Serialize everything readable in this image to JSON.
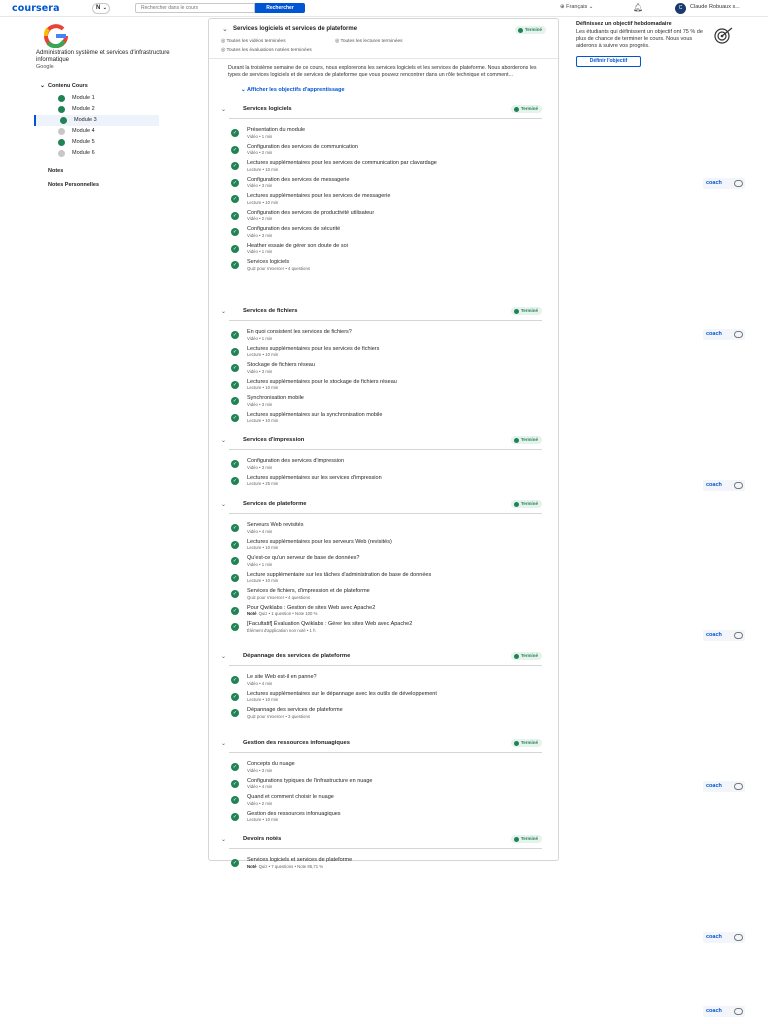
{
  "header": {
    "logo": "coursera",
    "badge_letter": "N",
    "badge_chevron": "⌄",
    "search_placeholder": "Rechercher dans le cours",
    "search_button": "Rechercher",
    "language": "Français",
    "avatar_letter": "C",
    "username": "Claude Robuaux s..."
  },
  "sidebar": {
    "course_title": "Administration système et services d'infrastructure informatique",
    "org": "Google",
    "toc_label": "Contenu Cours",
    "modules": [
      {
        "label": "Module 1",
        "status": "done"
      },
      {
        "label": "Module 2",
        "status": "done"
      },
      {
        "label": "Module 3",
        "status": "done",
        "active": true
      },
      {
        "label": "Module 4",
        "status": "todo"
      },
      {
        "label": "Module 5",
        "status": "done"
      },
      {
        "label": "Module 6",
        "status": "todo"
      }
    ],
    "notes": "Notes",
    "personal_notes": "Notes Personnelles"
  },
  "main": {
    "module_title": "Services logiciels et services de plateforme",
    "module_status": "Terminé",
    "filters": [
      "Toutes les vidéos terminées",
      "Toutes les lectures terminées",
      "Toutes les évaluations notées terminées"
    ],
    "description": "Durant la troisième semaine de ce cours, nous explorerons les services logiciels et les services de plateforme. Nous aborderons les types de services logiciels et de services de plateforme que vous pouvez rencontrer dans un rôle technique et comment...",
    "learning_objectives_link": "Afficher les objectifs d'apprentissage",
    "sections": [
      {
        "name": "Services logiciels",
        "status": "Terminé",
        "items": [
          {
            "title": "Présentation du module",
            "meta": "Vidéo • 1 min"
          },
          {
            "title": "Configuration des services de communication",
            "meta": "Vidéo • 2 min"
          },
          {
            "title": "Lectures supplémentaires pour les services de communication par clavardage",
            "meta": "Lecture • 10 min"
          },
          {
            "title": "Configuration des services de messagerie",
            "meta": "Vidéo • 3 min"
          },
          {
            "title": "Lectures supplémentaires pour les services de messagerie",
            "meta": "Lecture • 10 min"
          },
          {
            "title": "Configuration des services de productivité utilisateur",
            "meta": "Vidéo • 2 min"
          },
          {
            "title": "Configuration des services de sécurité",
            "meta": "Vidéo • 3 min"
          },
          {
            "title": "Heather essaie de gérer son doute de soi",
            "meta": "Vidéo • 1 min"
          },
          {
            "title": "Services logiciels",
            "meta": "Quiz pour s'exercer • 4 questions"
          }
        ]
      },
      {
        "name": "Services de fichiers",
        "status": "Terminé",
        "items": [
          {
            "title": "En quoi consistent les services de fichiers?",
            "meta": "Vidéo • 1 min"
          },
          {
            "title": "Lectures supplémentaires pour les services de fichiers",
            "meta": "Lecture • 10 min"
          },
          {
            "title": "Stockage de fichiers réseau",
            "meta": "Vidéo • 3 min"
          },
          {
            "title": "Lectures supplémentaires pour le stockage de fichiers réseau",
            "meta": "Lecture • 10 min"
          },
          {
            "title": "Synchronisation mobile",
            "meta": "Vidéo • 3 min"
          },
          {
            "title": "Lectures supplémentaires sur la synchronisation mobile",
            "meta": "Lecture • 10 min"
          }
        ]
      },
      {
        "name": "Services d'impression",
        "status": "Terminé",
        "items": [
          {
            "title": "Configuration des services d'impression",
            "meta": "Vidéo • 3 min"
          },
          {
            "title": "Lectures supplémentaires sur les services d'impression",
            "meta": "Lecture • 25 min"
          }
        ]
      },
      {
        "name": "Services de plateforme",
        "status": "Terminé",
        "items": [
          {
            "title": "Serveurs Web revisités",
            "meta": "Vidéo • 4 min"
          },
          {
            "title": "Lectures supplémentaires pour les serveurs Web (revisités)",
            "meta": "Lecture • 10 min"
          },
          {
            "title": "Qu'est-ce qu'un serveur de base de données?",
            "meta": "Vidéo • 1 min"
          },
          {
            "title": "Lecture supplémentaire sur les tâches d'administration de base de données",
            "meta": "Lecture • 10 min"
          },
          {
            "title": "Services de fichiers, d'impression et de plateforme",
            "meta": "Quiz pour s'exercer • 4 questions"
          },
          {
            "title": "Pour Qwiklabs : Gestion de sites Web avec Apache2",
            "graded": "Noté",
            "meta": "Quiz • 1 question • Note 100 %"
          },
          {
            "title": "[Facultatif] Évaluation Qwiklabs : Gérer les sites Web avec Apache2",
            "meta": "Élément d'application non noté • 1 h"
          }
        ]
      },
      {
        "name": "Dépannage des services de plateforme",
        "status": "Terminé",
        "items": [
          {
            "title": "Le site Web est-il en panne?",
            "meta": "Vidéo • 4 min"
          },
          {
            "title": "Lectures supplémentaires sur le dépannage avec les outils de développement",
            "meta": "Lecture • 10 min"
          },
          {
            "title": "Dépannage des services de plateforme",
            "meta": "Quiz pour s'exercer • 3 questions"
          }
        ]
      },
      {
        "name": "Gestion des ressources infonuagiques",
        "status": "Terminé",
        "items": [
          {
            "title": "Concepts du nuage",
            "meta": "Vidéo • 3 min"
          },
          {
            "title": "Configurations typiques de l'infrastructure en nuage",
            "meta": "Vidéo • 4 min"
          },
          {
            "title": "Quand et comment choisir le nuage",
            "meta": "Vidéo • 2 min"
          },
          {
            "title": "Gestion des ressources infonuagiques",
            "meta": "Lecture • 10 min"
          }
        ]
      },
      {
        "name": "Devoirs notés",
        "status": "Terminé",
        "items": [
          {
            "title": "Services logiciels et services de plateforme",
            "graded": "Noté",
            "meta": "Quiz • 7 questions • Note 85,71 %"
          }
        ]
      }
    ]
  },
  "goal": {
    "title": "Définissez un objectif hebdomadaire",
    "text": "Les étudiants qui définissent un objectif ont 75 % de plus de chance de terminer le cours. Nous vous aiderons à suivre vos progrès.",
    "button": "Définir l'objectif"
  },
  "coach_label": "coach",
  "colors": {
    "accent": "#0056d2",
    "success": "#1f8354",
    "success_bg": "#e6f2ec"
  }
}
